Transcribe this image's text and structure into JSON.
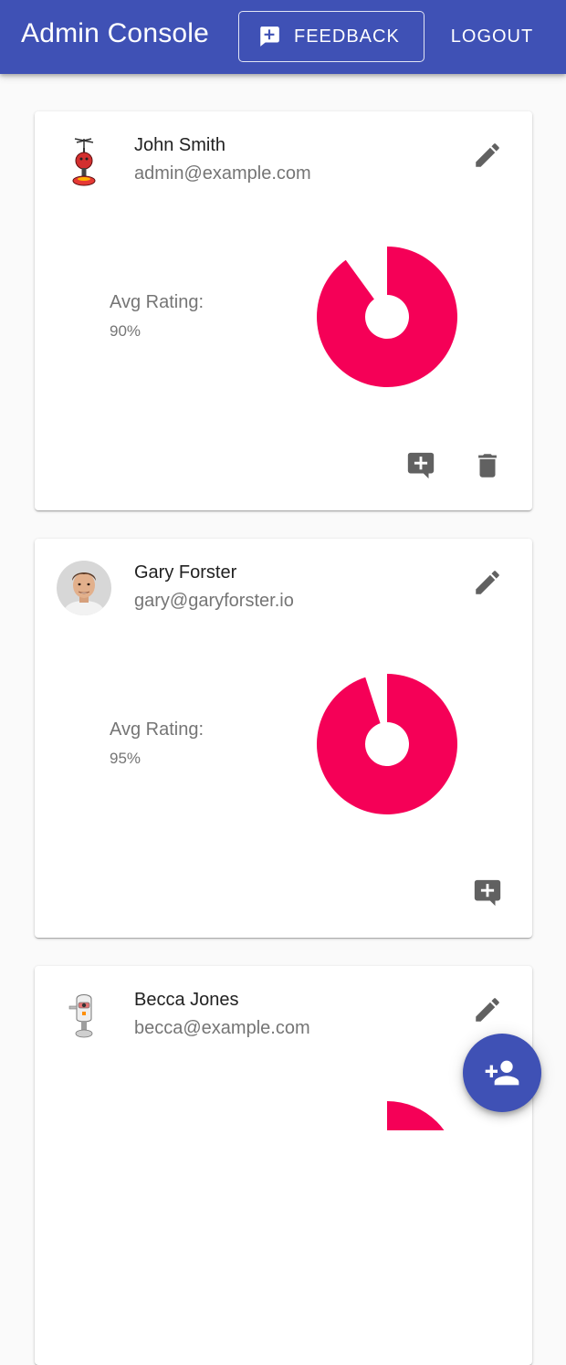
{
  "app": {
    "title": "Admin Console",
    "feedback_label": "FEEDBACK",
    "logout_label": "LOGOUT",
    "primary_color": "#3f51b5",
    "accent_color": "#f50057"
  },
  "users": [
    {
      "name": "John Smith",
      "email": "admin@example.com",
      "avatar_icon": "red-robot-avatar",
      "rating_label": "Avg Rating:",
      "rating_text": "90%",
      "rating_fraction": 0.9,
      "actions": [
        "add-comment-icon",
        "delete-icon"
      ]
    },
    {
      "name": "Gary Forster",
      "email": "gary@garyforster.io",
      "avatar_icon": "person-photo-avatar",
      "rating_label": "Avg Rating:",
      "rating_text": "95%",
      "rating_fraction": 0.95,
      "actions": [
        "add-comment-icon"
      ]
    },
    {
      "name": "Becca Jones",
      "email": "becca@example.com",
      "avatar_icon": "white-robot-avatar"
    }
  ],
  "fab": {
    "icon": "person-add-icon"
  }
}
